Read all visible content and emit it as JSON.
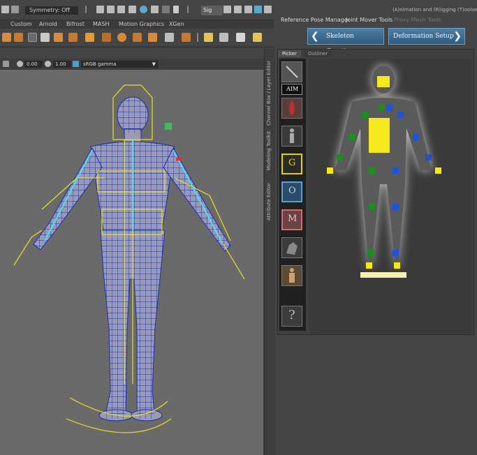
{
  "status_bar": {
    "symmetry": "Symmetry: Off",
    "sig_label": "Sig"
  },
  "shelf": {
    "tabs": [
      "Custom",
      "Arnold",
      "Bifrost",
      "MASH",
      "Motion Graphics",
      "XGen"
    ]
  },
  "viewport_header": {
    "value_a": "0.00",
    "value_b": "1.00",
    "color_space": "sRGB gamma"
  },
  "side_panels": [
    "Channel Box / Layer Editor",
    "Modeling Toolkit",
    "Attribute Editor"
  ],
  "toolset": {
    "title": "(A)nimation and (R)igging (T)oolset",
    "menu": [
      "Reference Pose Manager",
      "Joint Mover Tools",
      "Proxy Mesh Tools"
    ],
    "skeleton_button": "Skeleton Creation",
    "deformation_button": "Deformation Setup",
    "picker_tabs": [
      "Picker",
      "Outliner"
    ],
    "tool_buttons": {
      "aim": "AIM",
      "g": "G",
      "o": "O",
      "m": "M",
      "help": "?"
    }
  },
  "colors": {
    "accent_blue": "#3f6f95",
    "control_yellow": "#f5e81c",
    "control_green": "#1e8c1e",
    "control_blue": "#1d55d8",
    "wire_blue": "#1c2da8",
    "wire_yellow": "#e9e020"
  }
}
